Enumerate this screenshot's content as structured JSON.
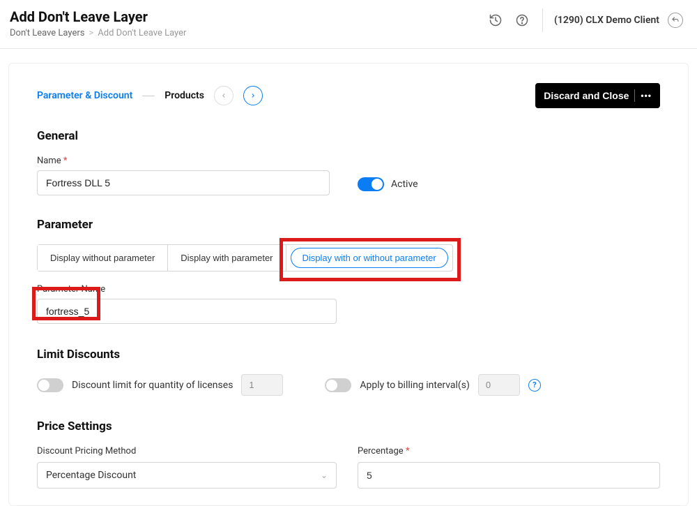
{
  "header": {
    "title": "Add Don't Leave Layer",
    "breadcrumb": {
      "root": "Don't Leave Layers",
      "sep": ">",
      "current": "Add Don't Leave Layer"
    },
    "client": "(1290) CLX Demo Client"
  },
  "wizard": {
    "step1": "Parameter & Discount",
    "step2": "Products",
    "discard": "Discard and Close"
  },
  "general": {
    "heading": "General",
    "name_label": "Name",
    "name_value": "Fortress DLL 5",
    "active_label": "Active"
  },
  "parameter": {
    "heading": "Parameter",
    "opt1": "Display without parameter",
    "opt2": "Display with parameter",
    "opt3": "Display with or without parameter",
    "param_name_label": "Parameter Name",
    "param_name_value": "fortress_5"
  },
  "limits": {
    "heading": "Limit Discounts",
    "qty_label": "Discount limit for quantity of licenses",
    "qty_value": "1",
    "billing_label": "Apply to billing interval(s)",
    "billing_value": "0"
  },
  "price": {
    "heading": "Price Settings",
    "method_label": "Discount Pricing Method",
    "method_value": "Percentage Discount",
    "percent_label": "Percentage",
    "percent_value": "5"
  }
}
